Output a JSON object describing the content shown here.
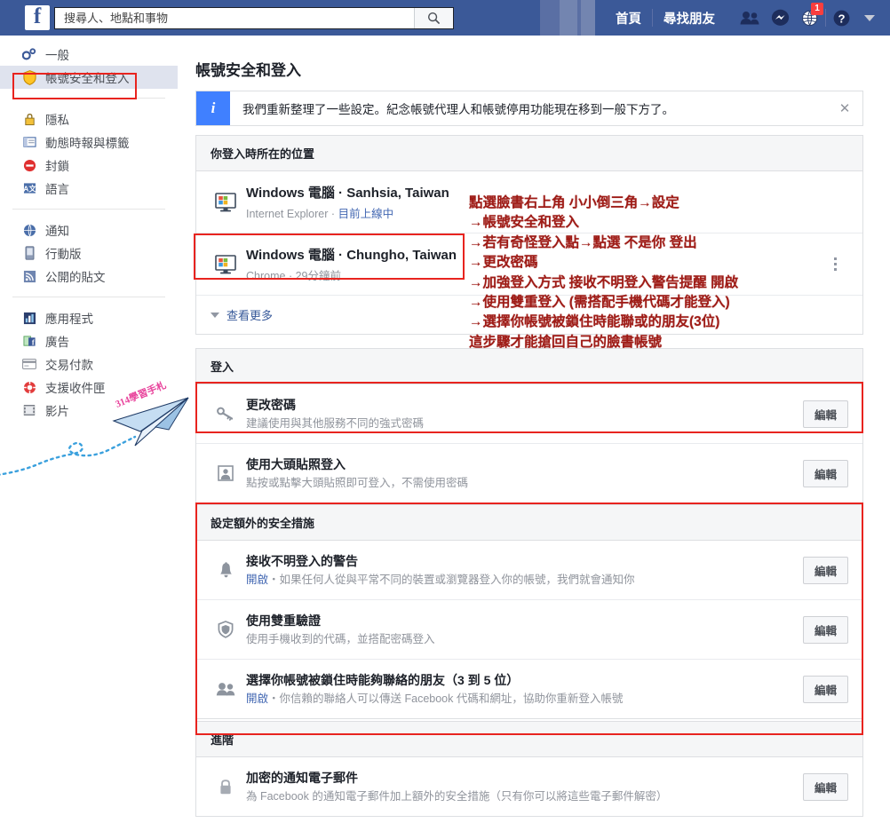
{
  "topbar": {
    "logo": "f",
    "search_placeholder": "搜尋人、地點和事物",
    "search_value": "",
    "search_icon": "search-icon",
    "home_label": "首頁",
    "find_friends_label": "尋找朋友",
    "friend_requests_icon": "friends-icon",
    "messenger_icon": "messenger-icon",
    "notifications_icon": "globe-icon",
    "notifications_badge": "1",
    "help_icon": "question-circle-icon",
    "account_menu_icon": "caret-down-icon",
    "brand_color": "#3b5998",
    "badge_color": "#fa3e3e"
  },
  "sidebar": {
    "groups": [
      {
        "items": [
          {
            "label": "一般",
            "icon": "gears-icon",
            "active": false
          },
          {
            "label": "帳號安全和登入",
            "icon": "shield-icon",
            "active": true
          }
        ]
      },
      {
        "items": [
          {
            "label": "隱私",
            "icon": "lock-icon",
            "active": false
          },
          {
            "label": "動態時報與標籤",
            "icon": "timeline-icon",
            "active": false
          },
          {
            "label": "封鎖",
            "icon": "block-icon",
            "active": false
          },
          {
            "label": "語言",
            "icon": "language-icon",
            "active": false
          }
        ]
      },
      {
        "items": [
          {
            "label": "通知",
            "icon": "globe-icon",
            "active": false
          },
          {
            "label": "行動版",
            "icon": "mobile-icon",
            "active": false
          },
          {
            "label": "公開的貼文",
            "icon": "rss-icon",
            "active": false
          }
        ]
      },
      {
        "items": [
          {
            "label": "應用程式",
            "icon": "apps-icon",
            "active": false
          },
          {
            "label": "廣告",
            "icon": "ads-icon",
            "active": false
          },
          {
            "label": "交易付款",
            "icon": "credit-card-icon",
            "active": false
          },
          {
            "label": "支援收件匣",
            "icon": "lifebuoy-icon",
            "active": false
          },
          {
            "label": "影片",
            "icon": "film-icon",
            "active": false
          }
        ]
      }
    ]
  },
  "main": {
    "page_title": "帳號安全和登入",
    "info_banner": {
      "icon": "info-icon",
      "text": "我們重新整理了一些設定。紀念帳號代理人和帳號停用功能現在移到一般下方了。",
      "close_icon": "close-icon",
      "accent_color": "#4080ff"
    },
    "sections": [
      {
        "header": "你登入時所在的位置",
        "sessions": [
          {
            "icon": "windows-monitor-icon",
            "title": "Windows 電腦 · Sanhsia, Taiwan",
            "browser": "Internet Explorer",
            "separator": "·",
            "status": "目前上線中",
            "status_is_link": true,
            "kebab": false
          },
          {
            "icon": "windows-monitor-icon",
            "title": "Windows 電腦 · Chungho, Taiwan",
            "browser": "Chrome",
            "separator": "·",
            "status": "29分鐘前",
            "status_is_link": false,
            "kebab": true,
            "kebab_icon": "kebab-menu-icon"
          }
        ],
        "see_more": "查看更多",
        "see_more_icon": "caret-down-icon"
      },
      {
        "header": "登入",
        "rows": [
          {
            "icon": "key-icon",
            "title": "更改密碼",
            "subtitle": "建議使用與其他服務不同的強式密碼",
            "status": "",
            "button": "編輯"
          },
          {
            "icon": "profile-photo-icon",
            "title": "使用大頭貼照登入",
            "subtitle": "點按或點擊大頭貼照即可登入，不需使用密碼",
            "status": "",
            "button": "編輯"
          }
        ]
      },
      {
        "header": "設定額外的安全措施",
        "rows": [
          {
            "icon": "bell-icon",
            "title": "接收不明登入的警告",
            "status": "開啟",
            "subtitle": "・如果任何人從與平常不同的裝置或瀏覽器登入你的帳號，我們就會通知你",
            "button": "編輯"
          },
          {
            "icon": "shield-icon",
            "title": "使用雙重驗證",
            "status": "",
            "subtitle": "使用手機收到的代碼，並搭配密碼登入",
            "button": "編輯"
          },
          {
            "icon": "friends-icon",
            "title": "選擇你帳號被鎖住時能夠聯絡的朋友（3 到 5 位）",
            "status": "開啟",
            "subtitle": "・你信賴的聯絡人可以傳送 Facebook 代碼和網址，協助你重新登入帳號",
            "button": "編輯"
          }
        ]
      },
      {
        "header": "進階",
        "rows": [
          {
            "icon": "padlock-icon",
            "title": "加密的通知電子郵件",
            "status": "",
            "subtitle": "為 Facebook 的通知電子郵件加上額外的安全措施（只有你可以將這些電子郵件解密）",
            "button": "編輯"
          }
        ]
      }
    ]
  },
  "annotations": {
    "color": "#9e1b16",
    "lines": [
      "點選臉書右上角 小小倒三角→設定",
      "→帳號安全和登入",
      "→若有奇怪登入點→點選 不是你 登出",
      "→更改密碼",
      "→加強登入方式 接收不明登入警告提醒 開啟",
      "→使用雙重登入 (需搭配手機代碼才能登入)",
      "→選擇你帳號被鎖住時能聯或的朋友(3位)",
      "這步驟才能搶回自己的臉書帳號"
    ],
    "watermark": {
      "text": "314學習手札",
      "color": "#e8429b",
      "icon": "paper-plane-icon"
    },
    "box_color": "#e8241f"
  }
}
